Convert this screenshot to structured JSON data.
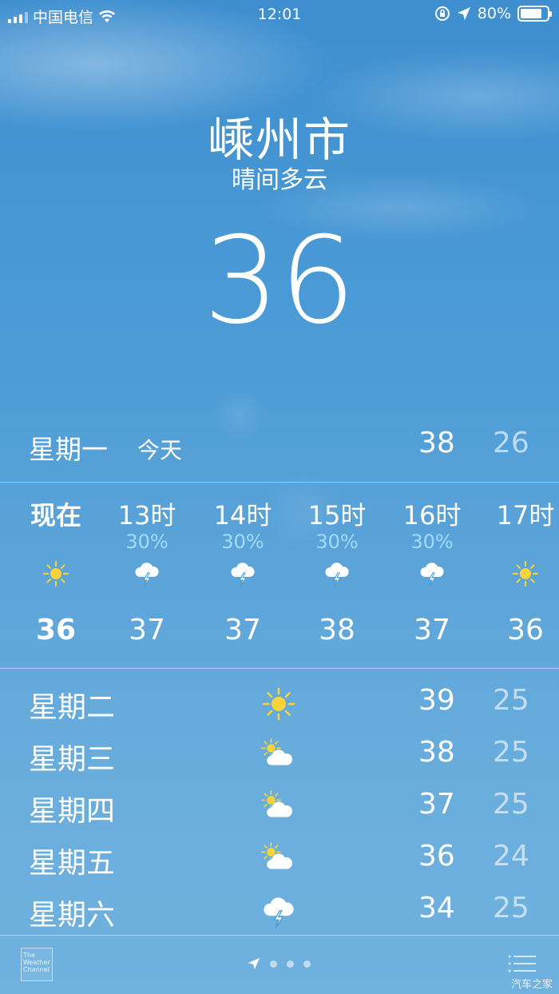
{
  "status_bar": {
    "carrier": "中国电信",
    "time": "12:01",
    "battery": "80%",
    "battery_level": 0.8
  },
  "header": {
    "city": "嵊州市",
    "condition": "晴间多云",
    "temperature": "36"
  },
  "today": {
    "day": "星期一",
    "label": "今天",
    "high": "38",
    "low": "26"
  },
  "hourly": [
    {
      "time": "现在",
      "precip": "",
      "icon": "sun-icon",
      "temp": "36"
    },
    {
      "time": "13时",
      "precip": "30%",
      "icon": "thunderstorm-icon",
      "temp": "37"
    },
    {
      "time": "14时",
      "precip": "30%",
      "icon": "thunderstorm-icon",
      "temp": "37"
    },
    {
      "time": "15时",
      "precip": "30%",
      "icon": "thunderstorm-icon",
      "temp": "38"
    },
    {
      "time": "16时",
      "precip": "30%",
      "icon": "thunderstorm-icon",
      "temp": "37"
    },
    {
      "time": "17时",
      "precip": "",
      "icon": "sun-icon",
      "temp": "36"
    }
  ],
  "daily": [
    {
      "day": "星期二",
      "icon": "sun-icon",
      "high": "39",
      "low": "25"
    },
    {
      "day": "星期三",
      "icon": "partly-cloudy-icon",
      "high": "38",
      "low": "25"
    },
    {
      "day": "星期四",
      "icon": "partly-cloudy-icon",
      "high": "37",
      "low": "25"
    },
    {
      "day": "星期五",
      "icon": "partly-cloudy-icon",
      "high": "36",
      "low": "24"
    },
    {
      "day": "星期六",
      "icon": "thunderstorm-icon",
      "high": "34",
      "low": "25"
    }
  ],
  "footer": {
    "logo_line1": "The",
    "logo_line2": "Weather",
    "logo_line3": "Channel",
    "watermark": "汽车之家"
  },
  "colors": {
    "precip": "#9fdcff",
    "sun": "#f8d33a"
  }
}
